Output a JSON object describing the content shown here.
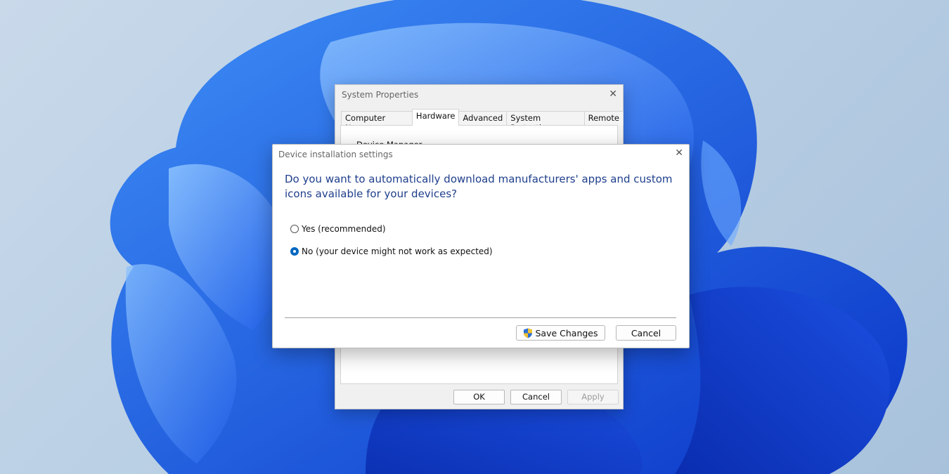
{
  "system_properties": {
    "title": "System Properties",
    "close_glyph": "✕",
    "tabs": [
      {
        "label": "Computer Name",
        "active": false
      },
      {
        "label": "Hardware",
        "active": true
      },
      {
        "label": "Advanced",
        "active": false
      },
      {
        "label": "System Protection",
        "active": false
      },
      {
        "label": "Remote",
        "active": false
      }
    ],
    "device_manager_label": "Device Manager",
    "buttons": {
      "ok": "OK",
      "cancel": "Cancel",
      "apply": "Apply"
    }
  },
  "device_install_dialog": {
    "title": "Device installation settings",
    "close_glyph": "✕",
    "question": "Do you want to automatically download manufacturers' apps and custom icons available for your devices?",
    "options": [
      {
        "label": "Yes (recommended)",
        "checked": false
      },
      {
        "label": "No (your device might not work as expected)",
        "checked": true
      }
    ],
    "save_label": "Save Changes",
    "cancel_label": "Cancel",
    "accent_color": "#0067c0",
    "shield_icon": "uac-shield-icon"
  }
}
